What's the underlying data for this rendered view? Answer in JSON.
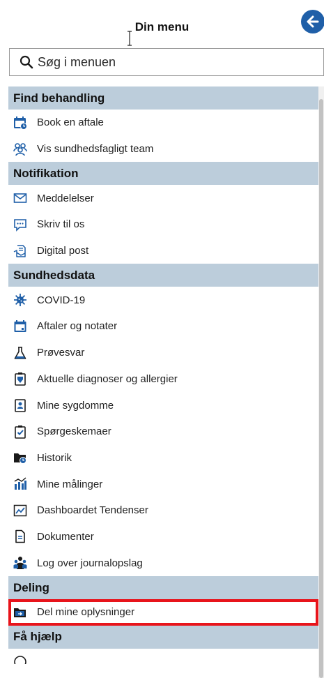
{
  "header": {
    "title": "Din menu",
    "back_label": "Tilbage"
  },
  "search": {
    "placeholder": "Søg i menuen"
  },
  "colors": {
    "accent": "#1f5fa8",
    "section_bg": "#bccddb",
    "highlight": "#e8141b"
  },
  "sections": [
    {
      "title": "Find behandling",
      "items": [
        {
          "label": "Book en aftale",
          "icon": "calendar-clock-icon"
        },
        {
          "label": "Vis sundhedsfagligt team",
          "icon": "team-icon"
        }
      ]
    },
    {
      "title": "Notifikation",
      "items": [
        {
          "label": "Meddelelser",
          "icon": "envelope-icon"
        },
        {
          "label": "Skriv til os",
          "icon": "chat-icon"
        },
        {
          "label": "Digital post",
          "icon": "digital-post-icon"
        }
      ]
    },
    {
      "title": "Sundhedsdata",
      "items": [
        {
          "label": "COVID-19",
          "icon": "virus-icon"
        },
        {
          "label": "Aftaler og notater",
          "icon": "calendar-icon"
        },
        {
          "label": "Prøvesvar",
          "icon": "flask-icon"
        },
        {
          "label": "Aktuelle diagnoser og allergier",
          "icon": "clipboard-icon"
        },
        {
          "label": "Mine sygdomme",
          "icon": "person-card-icon"
        },
        {
          "label": "Spørgeskemaer",
          "icon": "checklist-icon"
        },
        {
          "label": "Historik",
          "icon": "folder-clock-icon"
        },
        {
          "label": "Mine målinger",
          "icon": "measurements-icon"
        },
        {
          "label": "Dashboardet Tendenser",
          "icon": "trend-chart-icon"
        },
        {
          "label": "Dokumenter",
          "icon": "document-icon"
        },
        {
          "label": "Log over journalopslag",
          "icon": "people-log-icon"
        }
      ]
    },
    {
      "title": "Deling",
      "items": [
        {
          "label": "Del mine oplysninger",
          "icon": "folder-share-icon"
        }
      ]
    },
    {
      "title": "Få hjælp",
      "items": []
    }
  ]
}
